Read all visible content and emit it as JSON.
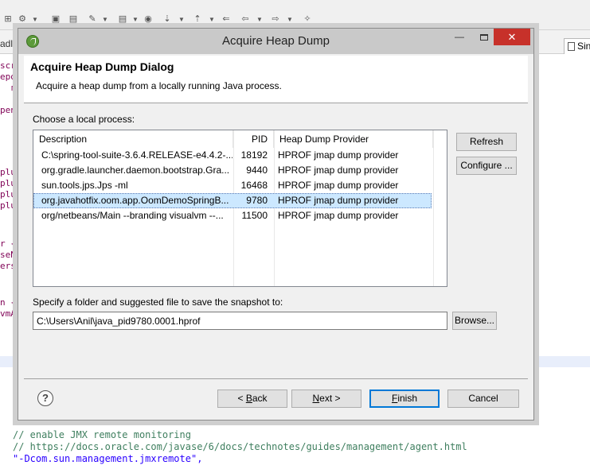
{
  "ide": {
    "tab_left_fragment": "adle",
    "tab_right_label": "Sin",
    "code_left_fragments": [
      "scri",
      "epos",
      "m",
      "pen",
      "c",
      "plu",
      "plu",
      "plu",
      "plu",
      "r {",
      "seN",
      "ersi",
      "n {",
      "vmAr",
      "/",
      "\"",
      "\"",
      "/",
      "\"",
      "\""
    ],
    "code_bottom": [
      {
        "text": "// enable JMX remote monitoring",
        "kind": "comment"
      },
      {
        "text": "// https://docs.oracle.com/javase/6/docs/technotes/guides/management/agent.html",
        "kind": "comment"
      },
      {
        "text": "\"-Dcom.sun.management.jmxremote\",",
        "kind": "string"
      }
    ]
  },
  "dialog": {
    "window_title": "Acquire Heap Dump",
    "header_title": "Acquire Heap Dump Dialog",
    "header_message": "Acquire a heap dump from a locally running Java process.",
    "process_label": "Choose a local process:",
    "columns": {
      "description": "Description",
      "pid": "PID",
      "provider": "Heap Dump Provider"
    },
    "rows": [
      {
        "description": "C:\\spring-tool-suite-3.6.4.RELEASE-e4.4.2-...",
        "pid": "18192",
        "provider": "HPROF jmap dump provider"
      },
      {
        "description": "org.gradle.launcher.daemon.bootstrap.Gra...",
        "pid": "9440",
        "provider": "HPROF jmap dump provider"
      },
      {
        "description": "sun.tools.jps.Jps -ml",
        "pid": "16468",
        "provider": "HPROF jmap dump provider"
      },
      {
        "description": "org.javahotfix.oom.app.OomDemoSpringB...",
        "pid": "9780",
        "provider": "HPROF jmap dump provider"
      },
      {
        "description": "org/netbeans/Main --branding visualvm --...",
        "pid": "11500",
        "provider": "HPROF jmap dump provider"
      }
    ],
    "selected_row": 3,
    "refresh_label": "Refresh",
    "configure_label": "Configure ...",
    "folder_label": "Specify a folder and suggested file to save the snapshot to:",
    "folder_value": "C:\\Users\\Anil\\java_pid9780.0001.hprof",
    "browse_label": "Browse...",
    "back_prefix": "< ",
    "back_mnemonic": "B",
    "back_rest": "ack",
    "next_mnemonic": "N",
    "next_rest": "ext >",
    "finish_mnemonic": "F",
    "finish_rest": "inish",
    "cancel_label": "Cancel",
    "help_glyph": "?"
  },
  "colors": {
    "selection": "#cce8ff",
    "close_button": "#c7312a",
    "primary_border": "#0078d7"
  }
}
